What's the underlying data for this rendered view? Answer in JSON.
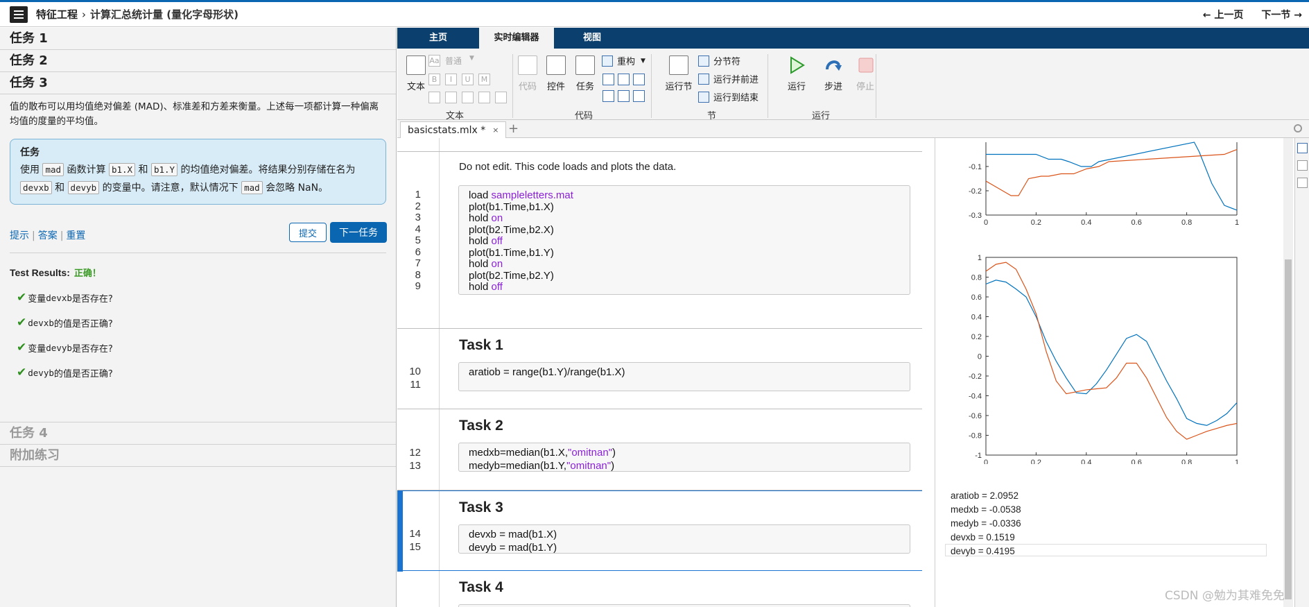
{
  "header": {
    "course": "特征工程",
    "separator": "›",
    "lesson": "计算汇总统计量 (量化字母形状)",
    "prev": "← 上一页",
    "next": "下一节 →"
  },
  "left": {
    "tasks": [
      {
        "label": "任务 1"
      },
      {
        "label": "任务 2"
      },
      {
        "label": "任务 3"
      },
      {
        "label": "任务 4"
      },
      {
        "label": "附加练习"
      }
    ],
    "description": "值的散布可以用均值绝对偏差 (MAD)、标准差和方差来衡量。上述每一项都计算一种偏离均值的度量的平均值。",
    "taskbox": {
      "title": "任务",
      "t1": "使用",
      "c1": "mad",
      "t2": "函数计算",
      "c2": "b1.X",
      "t3": "和",
      "c3": "b1.Y",
      "t4": "的均值绝对偏差。将结果分别存储在名为",
      "c4": "devxb",
      "t5": "和",
      "c5": "devyb",
      "t6": "的变量中。请注意，默认情况下",
      "c6": "mad",
      "t7": "会忽略 NaN。"
    },
    "links": {
      "hint": "提示",
      "answer": "答案",
      "reset": "重置"
    },
    "submit": "提交",
    "next_task": "下一任务",
    "results": {
      "title": "Test Results:",
      "status": "正确！",
      "checks": [
        {
          "pre": "变量 ",
          "code": "devxb",
          "post": " 是否存在?"
        },
        {
          "pre": "",
          "code": "devxb",
          "post": " 的值是否正确?"
        },
        {
          "pre": "变量 ",
          "code": "devyb",
          "post": " 是否存在?"
        },
        {
          "pre": "",
          "code": "devyb",
          "post": " 的值是否正确?"
        }
      ]
    }
  },
  "ribbon": {
    "tabs": [
      "主页",
      "实时编辑器",
      "视图"
    ],
    "active_tab": "实时编辑器",
    "groups": {
      "text": "文本",
      "code": "代码",
      "section": "节",
      "run": "运行"
    },
    "buttons": {
      "text": "文本",
      "normal": "普通",
      "code": "代码",
      "control": "控件",
      "task": "任务",
      "refactor": "重构",
      "run_section": "运行节",
      "section_break": "分节符",
      "run_advance": "运行并前进",
      "run_to_end": "运行到结束",
      "run": "运行",
      "step": "步进",
      "stop": "停止"
    },
    "format_glyphs": [
      "Aa",
      "B",
      "I",
      "U",
      "M"
    ]
  },
  "file_tab": {
    "name": "basicstats.mlx *",
    "close": "×",
    "add": "+"
  },
  "editor": {
    "intro_text": "Do not edit. This code loads and plots the data.",
    "load_lines": [
      {
        "n": "1",
        "a": "load ",
        "k": "sampleletters.mat",
        "b": ""
      },
      {
        "n": "2",
        "a": "plot(b1.Time,b1.X)",
        "k": "",
        "b": ""
      },
      {
        "n": "3",
        "a": "hold ",
        "k": "on",
        "b": ""
      },
      {
        "n": "4",
        "a": "plot(b2.Time,b2.X)",
        "k": "",
        "b": ""
      },
      {
        "n": "5",
        "a": "hold ",
        "k": "off",
        "b": ""
      },
      {
        "n": "6",
        "a": "plot(b1.Time,b1.Y)",
        "k": "",
        "b": ""
      },
      {
        "n": "7",
        "a": "hold ",
        "k": "on",
        "b": ""
      },
      {
        "n": "8",
        "a": "plot(b2.Time,b2.Y)",
        "k": "",
        "b": ""
      },
      {
        "n": "9",
        "a": "hold ",
        "k": "off",
        "b": ""
      }
    ],
    "task1": {
      "title": "Task 1",
      "lines": [
        {
          "n": "10",
          "code": "aratiob = range(b1.Y)/range(b1.X)"
        },
        {
          "n": "11",
          "code": ""
        }
      ]
    },
    "task2": {
      "title": "Task 2",
      "lines": [
        {
          "n": "12",
          "a": "medxb=median(b1.X,",
          "k": "\"omitnan\"",
          "b": ")"
        },
        {
          "n": "13",
          "a": "medyb=median(b1.Y,",
          "k": "\"omitnan\"",
          "b": ")"
        }
      ]
    },
    "task3": {
      "title": "Task 3",
      "lines": [
        {
          "n": "14",
          "code": "devxb = mad(b1.X)"
        },
        {
          "n": "15",
          "code": "devyb = mad(b1.Y)"
        }
      ]
    },
    "task4": {
      "title": "Task 4"
    }
  },
  "output": {
    "values": [
      "aratiob = 2.0952",
      "medxb = -0.0538",
      "medyb = -0.0336",
      "devxb = 0.1519",
      "devyb = 0.4195"
    ]
  },
  "chart_data": [
    {
      "type": "line",
      "title": "",
      "xlabel": "",
      "ylabel": "",
      "xlim": [
        0,
        1
      ],
      "ylim": [
        -0.3,
        0
      ],
      "x_ticks": [
        "0",
        "0.2",
        "0.4",
        "0.6",
        "0.8",
        "1"
      ],
      "y_ticks": [
        "-0.1",
        "-0.2",
        "-0.3"
      ],
      "series": [
        {
          "color": "#0072bd",
          "x": [
            0,
            0.08,
            0.17,
            0.2,
            0.25,
            0.3,
            0.33,
            0.38,
            0.42,
            0.45,
            0.83,
            0.85,
            0.9,
            0.95,
            1.0
          ],
          "y": [
            -0.05,
            -0.05,
            -0.05,
            -0.05,
            -0.07,
            -0.07,
            -0.08,
            -0.1,
            -0.1,
            -0.08,
            0.0,
            -0.04,
            -0.17,
            -0.26,
            -0.28
          ]
        },
        {
          "color": "#d95319",
          "x": [
            0,
            0.05,
            0.1,
            0.13,
            0.17,
            0.22,
            0.25,
            0.3,
            0.35,
            0.4,
            0.45,
            0.49,
            0.95,
            1.0
          ],
          "y": [
            -0.16,
            -0.19,
            -0.22,
            -0.22,
            -0.15,
            -0.14,
            -0.14,
            -0.13,
            -0.13,
            -0.11,
            -0.1,
            -0.08,
            -0.05,
            -0.03
          ]
        }
      ]
    },
    {
      "type": "line",
      "title": "",
      "xlabel": "",
      "ylabel": "",
      "xlim": [
        0,
        1
      ],
      "ylim": [
        -1,
        1
      ],
      "x_ticks": [
        "0",
        "0.2",
        "0.4",
        "0.6",
        "0.8",
        "1"
      ],
      "y_ticks": [
        "1",
        "0.8",
        "0.6",
        "0.4",
        "0.2",
        "0",
        "-0.2",
        "-0.4",
        "-0.6",
        "-0.8",
        "-1"
      ],
      "series": [
        {
          "color": "#0072bd",
          "x": [
            0,
            0.04,
            0.08,
            0.12,
            0.16,
            0.2,
            0.24,
            0.28,
            0.32,
            0.36,
            0.4,
            0.44,
            0.48,
            0.52,
            0.56,
            0.6,
            0.64,
            0.68,
            0.72,
            0.76,
            0.8,
            0.84,
            0.88,
            0.92,
            0.96,
            1.0
          ],
          "y": [
            0.73,
            0.77,
            0.75,
            0.68,
            0.6,
            0.4,
            0.15,
            -0.05,
            -0.22,
            -0.37,
            -0.38,
            -0.28,
            -0.14,
            0.02,
            0.18,
            0.22,
            0.15,
            -0.05,
            -0.25,
            -0.43,
            -0.63,
            -0.68,
            -0.7,
            -0.65,
            -0.58,
            -0.47
          ]
        },
        {
          "color": "#d95319",
          "x": [
            0,
            0.04,
            0.08,
            0.12,
            0.16,
            0.2,
            0.24,
            0.28,
            0.32,
            0.36,
            0.4,
            0.44,
            0.48,
            0.52,
            0.56,
            0.6,
            0.64,
            0.68,
            0.72,
            0.76,
            0.8,
            0.84,
            0.88,
            0.92,
            0.96,
            1.0
          ],
          "y": [
            0.86,
            0.93,
            0.95,
            0.88,
            0.68,
            0.43,
            0.05,
            -0.25,
            -0.38,
            -0.36,
            -0.34,
            -0.33,
            -0.32,
            -0.22,
            -0.07,
            -0.07,
            -0.22,
            -0.42,
            -0.62,
            -0.76,
            -0.84,
            -0.8,
            -0.76,
            -0.73,
            -0.7,
            -0.68
          ]
        }
      ]
    }
  ]
}
